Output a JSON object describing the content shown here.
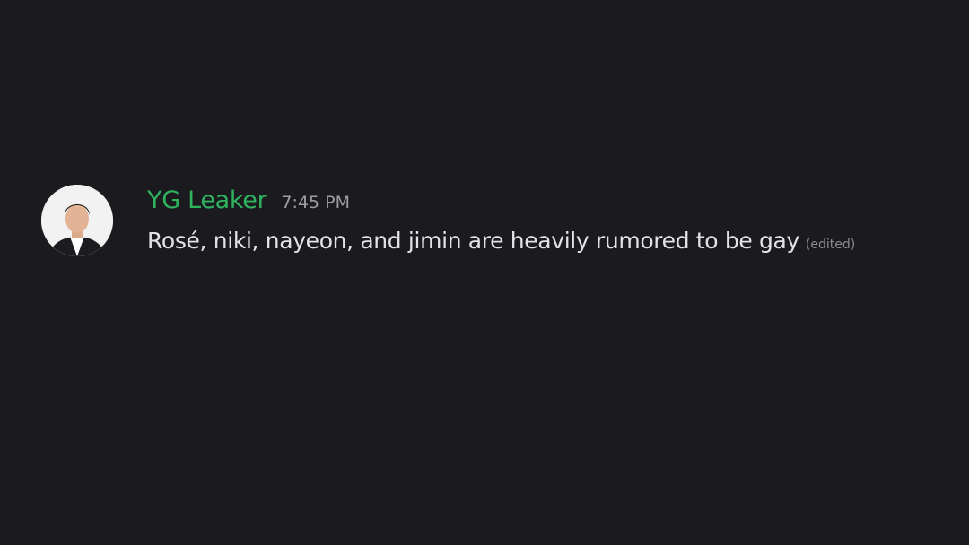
{
  "message": {
    "avatar_icon": "user-avatar-photo",
    "username": "YG Leaker",
    "username_color": "#2fb35f",
    "timestamp": "7:45 PM",
    "text": "Rosé, niki, nayeon, and jimin are heavily rumored to be gay",
    "edited_label": "(edited)"
  },
  "colors": {
    "background": "#1b1a1f",
    "text": "#e3e3e6",
    "muted": "#9d9ea4"
  }
}
